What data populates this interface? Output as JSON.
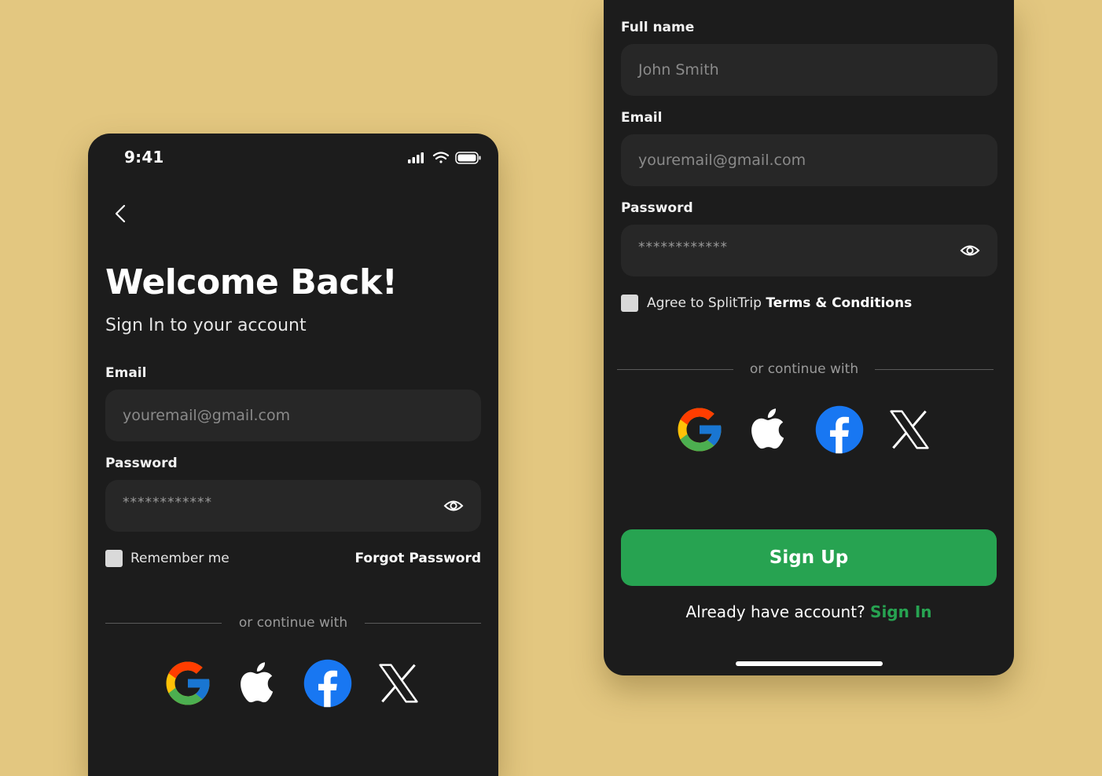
{
  "left_screen": {
    "status_time": "9:41",
    "title": "Welcome Back!",
    "subtitle": "Sign In to your account",
    "email_label": "Email",
    "email_placeholder": "youremail@gmail.com",
    "password_label": "Password",
    "password_mask": "************",
    "remember_label": "Remember me",
    "forgot_label": "Forgot Password",
    "divider_text": "or continue with"
  },
  "right_screen": {
    "fullname_label": "Full name",
    "fullname_placeholder": "John Smith",
    "email_label": "Email",
    "email_placeholder": "youremail@gmail.com",
    "password_label": "Password",
    "password_mask": "************",
    "agree_text": "Agree to SplitTrip ",
    "terms_text": "Terms & Conditions",
    "divider_text": "or continue with",
    "signup_button": "Sign Up",
    "have_account_text": "Already have account? ",
    "signin_link": "Sign In"
  },
  "social_icons": [
    "google-icon",
    "apple-icon",
    "facebook-icon",
    "x-icon"
  ],
  "colors": {
    "background": "#e3c780",
    "phone": "#1c1c1c",
    "field": "#272727",
    "accent_green": "#27a351",
    "facebook_blue": "#1877f2"
  }
}
